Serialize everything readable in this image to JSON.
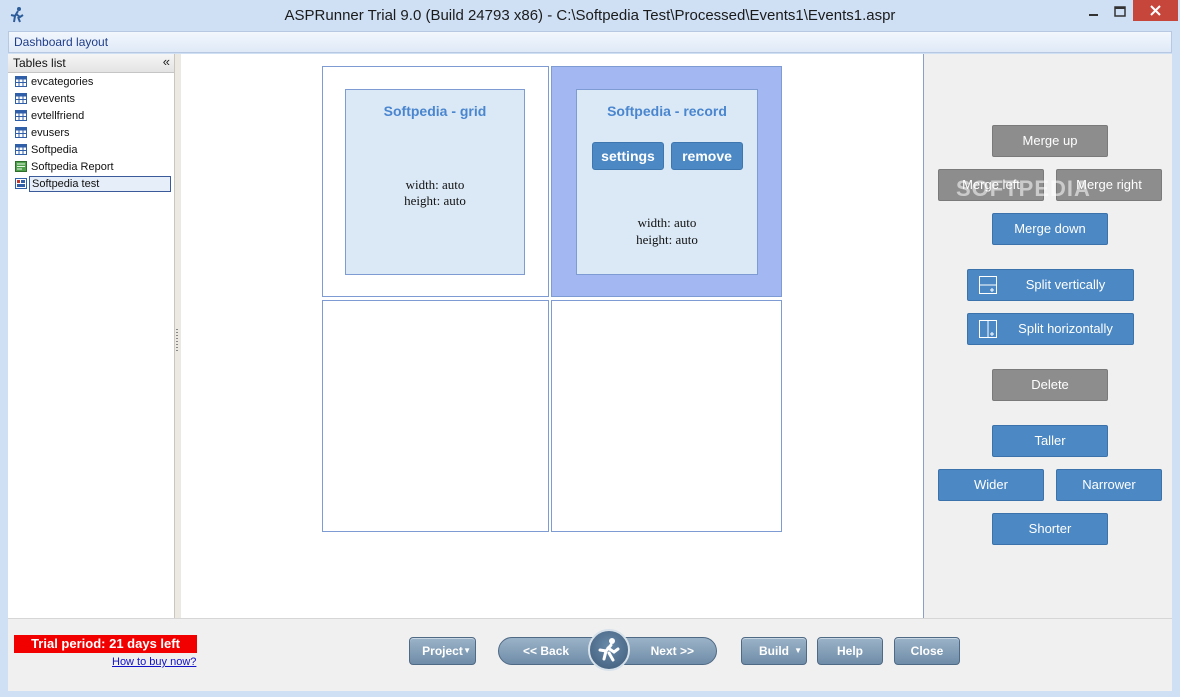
{
  "window": {
    "title": "ASPRunner Trial 9.0 (Build 24793 x86) - C:\\Softpedia Test\\Processed\\Events1\\Events1.aspr"
  },
  "menu": {
    "item": "Dashboard layout"
  },
  "tables_panel": {
    "header": "Tables list",
    "collapse_glyph": "«",
    "items": [
      {
        "label": "evcategories",
        "icon": "table-icon"
      },
      {
        "label": "evevents",
        "icon": "table-icon"
      },
      {
        "label": "evtellfriend",
        "icon": "table-icon"
      },
      {
        "label": "evusers",
        "icon": "table-icon"
      },
      {
        "label": "Softpedia",
        "icon": "table-icon"
      },
      {
        "label": "Softpedia Report",
        "icon": "report-icon"
      },
      {
        "label": "Softpedia test",
        "icon": "dashboard-icon",
        "selected": true
      }
    ]
  },
  "dashboard": {
    "grid_block": {
      "title": "Softpedia - grid",
      "width": "width: auto",
      "height": "height: auto"
    },
    "record_block": {
      "title": "Softpedia - record",
      "settings_label": "settings",
      "remove_label": "remove",
      "width": "width: auto",
      "height": "height: auto"
    }
  },
  "layout_actions": {
    "merge_up": "Merge up",
    "merge_left": "Merge left",
    "merge_right": "Merge right",
    "merge_down": "Merge down",
    "split_vertically": "Split vertically",
    "split_horizontally": "Split horizontally",
    "delete": "Delete",
    "taller": "Taller",
    "wider": "Wider",
    "narrower": "Narrower",
    "shorter": "Shorter",
    "watermark": "SOFTPEDIA"
  },
  "footer": {
    "trial": "Trial period: 21 days left",
    "how_to_buy": "How to buy now?",
    "project": "Project",
    "back": "<< Back",
    "next": "Next >>",
    "build": "Build",
    "help": "Help",
    "close": "Close"
  },
  "colors": {
    "accent_blue": "#4b88c4",
    "selected_cell": "#a3b7f2",
    "trial_red": "#f20000"
  }
}
